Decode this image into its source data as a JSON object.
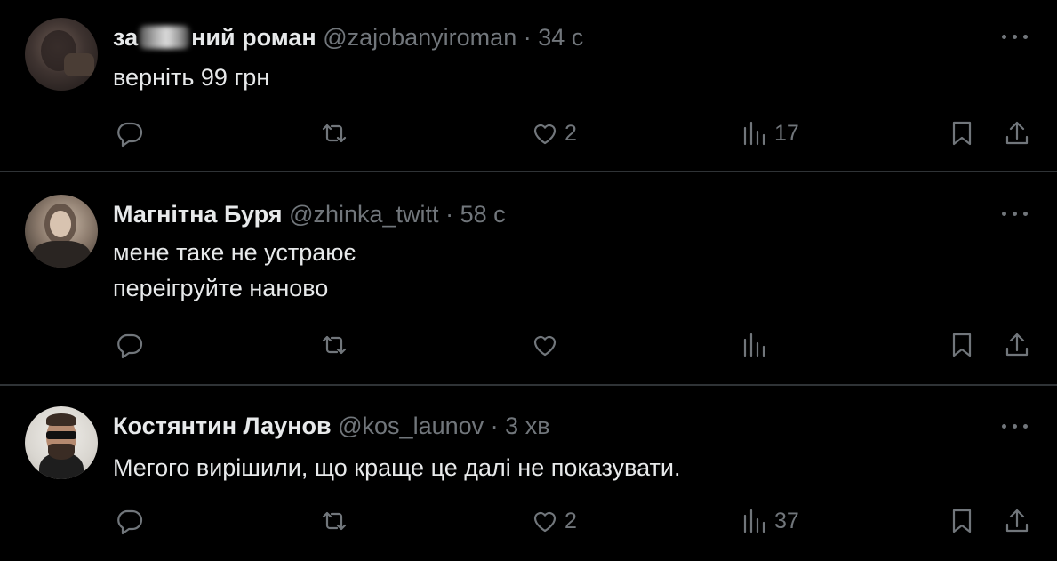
{
  "tweets": [
    {
      "name_prefix": "за",
      "name_suffix": "ний роман",
      "handle": "@zajobanyiroman",
      "separator": "·",
      "time": "34 с",
      "lines": [
        "верніть 99 грн"
      ],
      "likes": "2",
      "views": "17"
    },
    {
      "name": "Магнітна Буря",
      "handle": "@zhinka_twitt",
      "separator": "·",
      "time": "58 с",
      "lines": [
        "мене таке не устраює",
        "переігруйте наново"
      ],
      "likes": "",
      "views": ""
    },
    {
      "name": "Костянтин Лаунов",
      "handle": "@kos_launov",
      "separator": "·",
      "time": "3 хв",
      "lines": [
        "Мегого вирішили, що краще це далі не показувати."
      ],
      "likes": "2",
      "views": "37"
    }
  ],
  "colors": {
    "background": "#000000",
    "text": "#e7e9ea",
    "muted": "#71767b",
    "divider": "#2f3336"
  },
  "icons": [
    "reply-icon",
    "retweet-icon",
    "like-icon",
    "views-icon",
    "bookmark-icon",
    "share-icon",
    "more-icon"
  ]
}
